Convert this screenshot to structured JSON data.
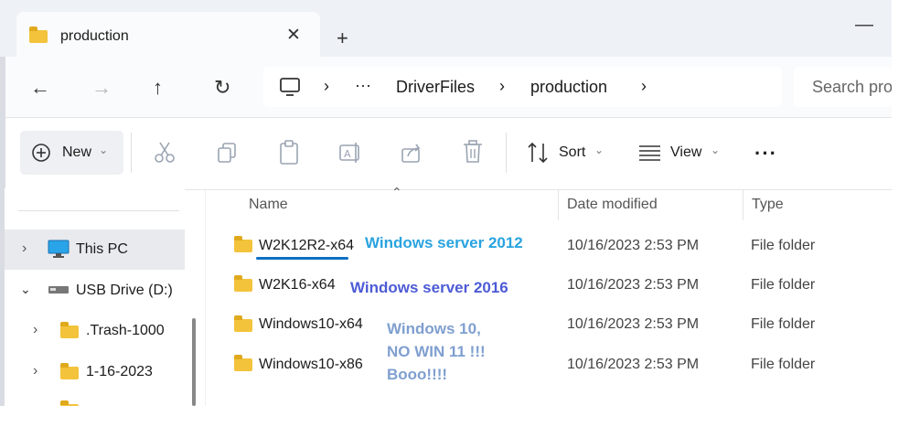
{
  "tab": {
    "title": "production"
  },
  "nav": {
    "back_icon": "back-arrow-icon",
    "breadcrumb": [
      "DriverFiles",
      "production"
    ],
    "ellipsis": "···",
    "search_placeholder": "Search pro"
  },
  "toolbar": {
    "new_label": "New",
    "sort_label": "Sort",
    "view_label": "View",
    "more_label": "···"
  },
  "sidebar": {
    "items": [
      {
        "label": "This PC",
        "selected": true
      },
      {
        "label": "USB Drive (D:)"
      },
      {
        "label": ".Trash-1000"
      },
      {
        "label": "1-16-2023"
      }
    ]
  },
  "columns": {
    "name": "Name",
    "date": "Date modified",
    "type": "Type"
  },
  "files": [
    {
      "name": "W2K12R2-x64",
      "date": "10/16/2023 2:53 PM",
      "type": "File folder"
    },
    {
      "name": "W2K16-x64",
      "date": "10/16/2023 2:53 PM",
      "type": "File folder"
    },
    {
      "name": "Windows10-x64",
      "date": "10/16/2023 2:53 PM",
      "type": "File folder"
    },
    {
      "name": "Windows10-x86",
      "date": "10/16/2023 2:53 PM",
      "type": "File folder"
    }
  ],
  "annotations": {
    "a1": "Windows server 2012",
    "a2": "Windows server 2016",
    "a3_line1": "Windows 10,",
    "a3_line2": "NO WIN 11 !!!",
    "a3_line3": "Booo!!!!",
    "colors": {
      "a1": "#29a3e0",
      "a2": "#4d5bd6",
      "a3": "#7f9fcf"
    }
  }
}
